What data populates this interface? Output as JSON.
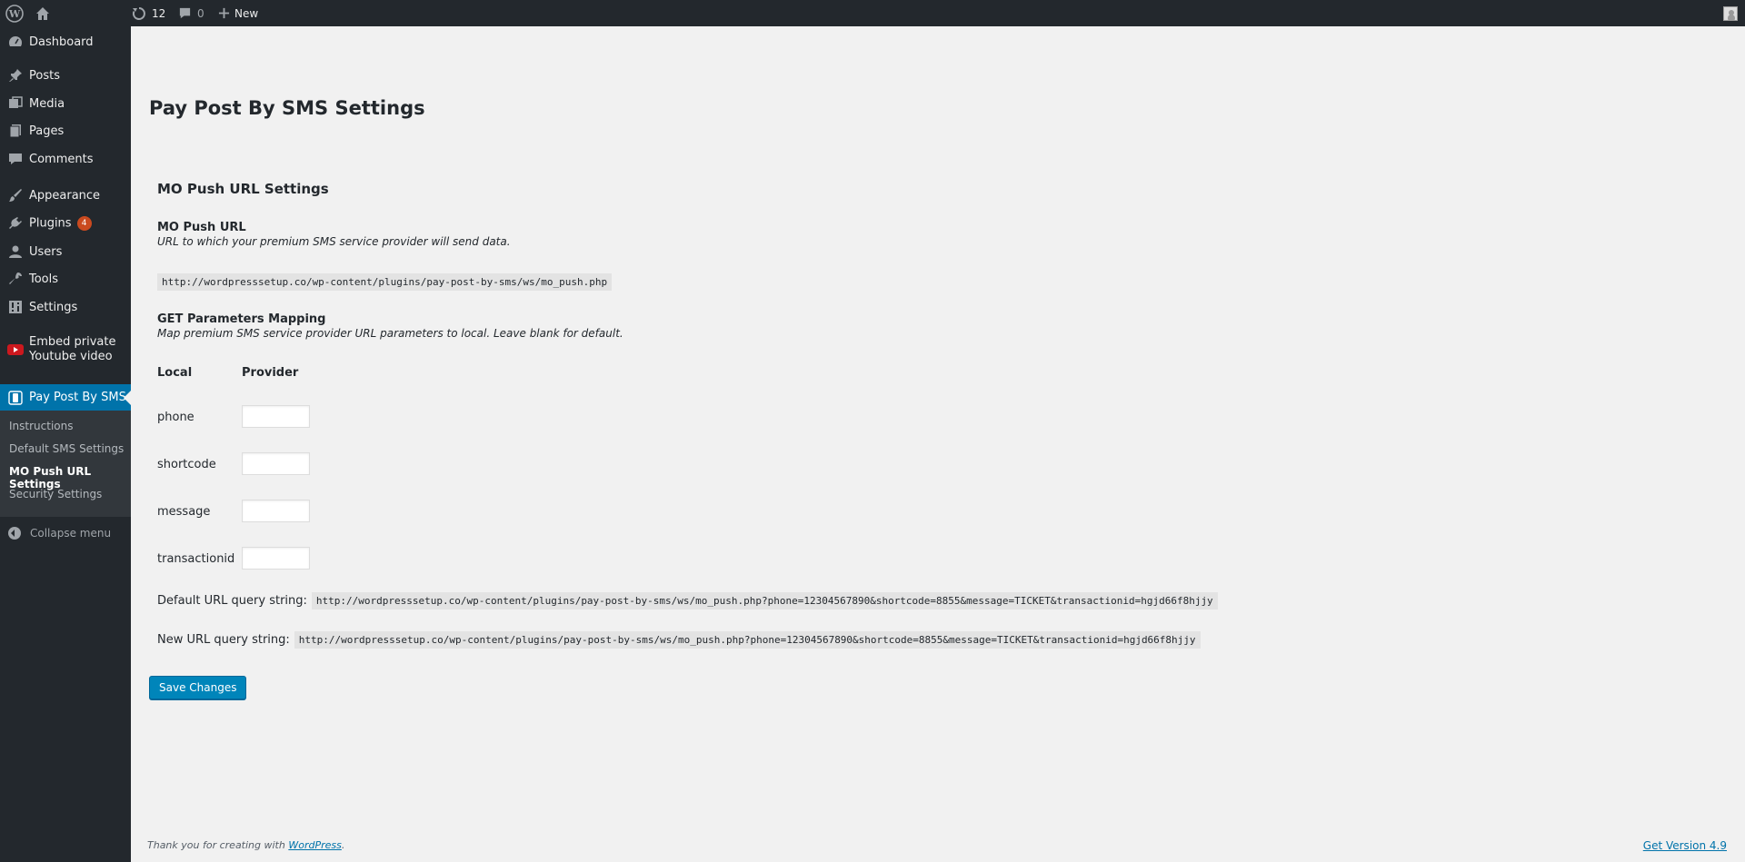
{
  "adminbar": {
    "updates_count": "12",
    "comments_count": "0",
    "new_label": "New"
  },
  "sidebar": {
    "items": [
      {
        "label": "Dashboard",
        "icon": "dashboard-icon"
      },
      {
        "label": "Posts",
        "icon": "pushpin-icon"
      },
      {
        "label": "Media",
        "icon": "media-icon"
      },
      {
        "label": "Pages",
        "icon": "pages-icon"
      },
      {
        "label": "Comments",
        "icon": "comment-icon"
      },
      {
        "label": "Appearance",
        "icon": "paintbrush-icon"
      },
      {
        "label": "Plugins",
        "icon": "plugin-icon",
        "badge": "4"
      },
      {
        "label": "Users",
        "icon": "user-icon"
      },
      {
        "label": "Tools",
        "icon": "wrench-icon"
      },
      {
        "label": "Settings",
        "icon": "settings-icon"
      },
      {
        "label_line1": "Embed private",
        "label_line2": "Youtube video",
        "icon": "youtube-icon"
      },
      {
        "label": "Pay Post By SMS",
        "icon": "phone-icon",
        "current": true
      }
    ],
    "submenu": [
      {
        "label": "Instructions"
      },
      {
        "label": "Default SMS Settings"
      },
      {
        "label": "MO Push URL Settings",
        "current": true
      },
      {
        "label": "Security Settings"
      }
    ],
    "collapse_label": "Collapse menu"
  },
  "main": {
    "page_title": "Pay Post By SMS Settings",
    "section_title": "MO Push URL Settings",
    "mo_push": {
      "label": "MO Push URL",
      "description": "URL to which your premium SMS service provider will send data.",
      "url": "http://wordpresssetup.co/wp-content/plugins/pay-post-by-sms/ws/mo_push.php"
    },
    "mapping": {
      "label": "GET Parameters Mapping",
      "description": "Map premium SMS service provider URL parameters to local. Leave blank for default.",
      "col_local": "Local",
      "col_provider": "Provider",
      "rows": [
        {
          "local": "phone",
          "provider": ""
        },
        {
          "local": "shortcode",
          "provider": ""
        },
        {
          "local": "message",
          "provider": ""
        },
        {
          "local": "transactionid",
          "provider": ""
        }
      ]
    },
    "default_query": {
      "label": "Default URL query string:",
      "value": "http://wordpresssetup.co/wp-content/plugins/pay-post-by-sms/ws/mo_push.php?phone=12304567890&shortcode=8855&message=TICKET&transactionid=hgjd66f8hjjy"
    },
    "new_query": {
      "label": "New URL query string:",
      "value": "http://wordpresssetup.co/wp-content/plugins/pay-post-by-sms/ws/mo_push.php?phone=12304567890&shortcode=8855&message=TICKET&transactionid=hgjd66f8hjjy"
    },
    "save_label": "Save Changes"
  },
  "footer": {
    "thanks_prefix": "Thank you for creating with ",
    "thanks_link": "WordPress",
    "thanks_suffix": ".",
    "version_link": "Get Version 4.9"
  },
  "colors": {
    "adminbar_bg": "#23282d",
    "menu_current": "#0073aa",
    "button_primary": "#0085ba",
    "badge": "#ca4a1f"
  }
}
